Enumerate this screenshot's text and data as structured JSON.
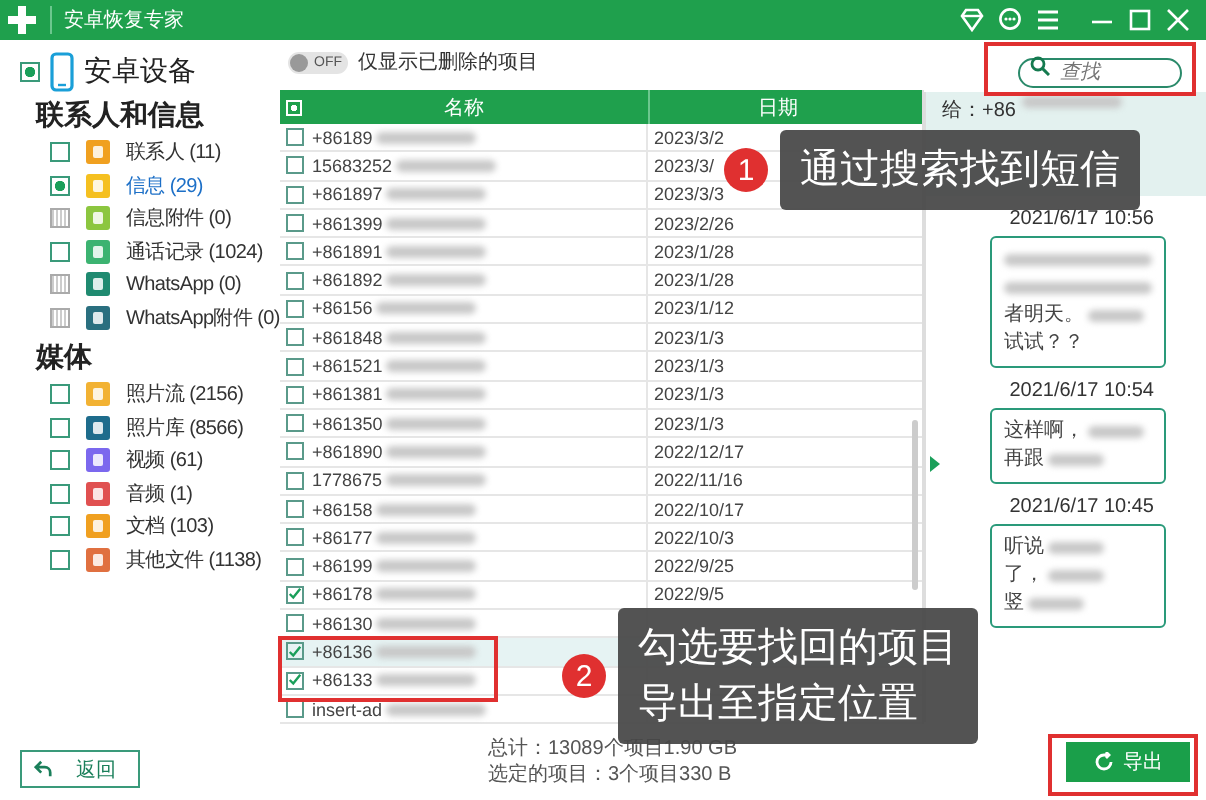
{
  "window": {
    "title": "安卓恢复专家"
  },
  "device": {
    "label": "安卓设备",
    "checked": true
  },
  "sidebar": {
    "groups": [
      {
        "title": "联系人和信息",
        "items": [
          {
            "label": "联系人 (11)",
            "checked": false,
            "disabled": false,
            "selected": false,
            "color": "#f0a020"
          },
          {
            "label": "信息 (29)",
            "checked": true,
            "disabled": false,
            "selected": true,
            "color": "#f5c020"
          },
          {
            "label": "信息附件 (0)",
            "checked": false,
            "disabled": true,
            "selected": false,
            "color": "#8cc63f"
          },
          {
            "label": "通话记录 (1024)",
            "checked": false,
            "disabled": false,
            "selected": false,
            "color": "#3cb371"
          },
          {
            "label": "WhatsApp (0)",
            "checked": false,
            "disabled": true,
            "selected": false,
            "color": "#1f8a70"
          },
          {
            "label": "WhatsApp附件 (0)",
            "checked": false,
            "disabled": true,
            "selected": false,
            "color": "#2a6f7f"
          }
        ]
      },
      {
        "title": "媒体",
        "items": [
          {
            "label": "照片流 (2156)",
            "checked": false,
            "disabled": false,
            "selected": false,
            "color": "#f2b233"
          },
          {
            "label": "照片库 (8566)",
            "checked": false,
            "disabled": false,
            "selected": false,
            "color": "#1e6c8c"
          },
          {
            "label": "视频 (61)",
            "checked": false,
            "disabled": false,
            "selected": false,
            "color": "#7b68ee"
          },
          {
            "label": "音频 (1)",
            "checked": false,
            "disabled": false,
            "selected": false,
            "color": "#e05050"
          },
          {
            "label": "文档 (103)",
            "checked": false,
            "disabled": false,
            "selected": false,
            "color": "#f0a020"
          },
          {
            "label": "其他文件 (1138)",
            "checked": false,
            "disabled": false,
            "selected": false,
            "color": "#e07040"
          }
        ]
      }
    ]
  },
  "filter": {
    "on": false,
    "switch_text": "OFF",
    "label": "仅显示已删除的项目"
  },
  "search": {
    "placeholder": "查找"
  },
  "table": {
    "columns": [
      "名称",
      "日期"
    ],
    "all_checked": true,
    "rows": [
      {
        "name": "+86189",
        "date": "2023/3/2",
        "checked": false,
        "selected": false
      },
      {
        "name": "15683252",
        "date": "2023/3/",
        "checked": false,
        "selected": false
      },
      {
        "name": "+861897",
        "date": "2023/3/3",
        "checked": false,
        "selected": false
      },
      {
        "name": "+861399",
        "date": "2023/2/26",
        "checked": false,
        "selected": false
      },
      {
        "name": "+861891",
        "date": "2023/1/28",
        "checked": false,
        "selected": false
      },
      {
        "name": "+861892",
        "date": "2023/1/28",
        "checked": false,
        "selected": false
      },
      {
        "name": "+86156",
        "date": "2023/1/12",
        "checked": false,
        "selected": false
      },
      {
        "name": "+861848",
        "date": "2023/1/3",
        "checked": false,
        "selected": false
      },
      {
        "name": "+861521",
        "date": "2023/1/3",
        "checked": false,
        "selected": false
      },
      {
        "name": "+861381",
        "date": "2023/1/3",
        "checked": false,
        "selected": false
      },
      {
        "name": "+861350",
        "date": "2023/1/3",
        "checked": false,
        "selected": false
      },
      {
        "name": "+861890",
        "date": "2022/12/17",
        "checked": false,
        "selected": false
      },
      {
        "name": "1778675",
        "date": "2022/11/16",
        "checked": false,
        "selected": false
      },
      {
        "name": "+86158",
        "date": "2022/10/17",
        "checked": false,
        "selected": false
      },
      {
        "name": "+86177",
        "date": "2022/10/3",
        "checked": false,
        "selected": false
      },
      {
        "name": "+86199",
        "date": "2022/9/25",
        "checked": false,
        "selected": false
      },
      {
        "name": "+86178",
        "date": "2022/9/5",
        "checked": true,
        "selected": false
      },
      {
        "name": "+86130",
        "checked": false,
        "selected": false
      },
      {
        "name": "+86136",
        "checked": true,
        "selected": true
      },
      {
        "name": "+86133",
        "checked": true,
        "selected": false
      },
      {
        "name": "insert-ad",
        "checked": false,
        "selected": false
      }
    ]
  },
  "stats": [
    "总计：13089个项目1.90 GB",
    "选定的项目：3个项目330 B"
  ],
  "preview": {
    "recipient": "给：+86",
    "messages": [
      {
        "time": "2021/6/17 10:56",
        "blurred_top": true,
        "lines": [
          {
            "text": "者明天。",
            "blurred": true
          },
          {
            "text": "试试？？",
            "blurred": false
          }
        ]
      },
      {
        "time": "2021/6/17 10:54",
        "blurred_top": false,
        "lines": [
          {
            "text": "这样啊，",
            "blurred": true
          },
          {
            "text": "再跟",
            "blurred": true
          }
        ]
      },
      {
        "time": "2021/6/17 10:45",
        "blurred_top": false,
        "lines": [
          {
            "text": "听说",
            "blurred": true
          },
          {
            "text": "了，",
            "blurred": true
          },
          {
            "text": "竖",
            "blurred": true
          }
        ]
      }
    ]
  },
  "buttons": {
    "back": "返回",
    "export": "导出"
  },
  "callouts": [
    {
      "number": "1",
      "lines": [
        "通过搜索找到短信"
      ]
    },
    {
      "number": "2",
      "lines": [
        "勾选要找回的项目",
        "导出至指定位置"
      ]
    }
  ]
}
